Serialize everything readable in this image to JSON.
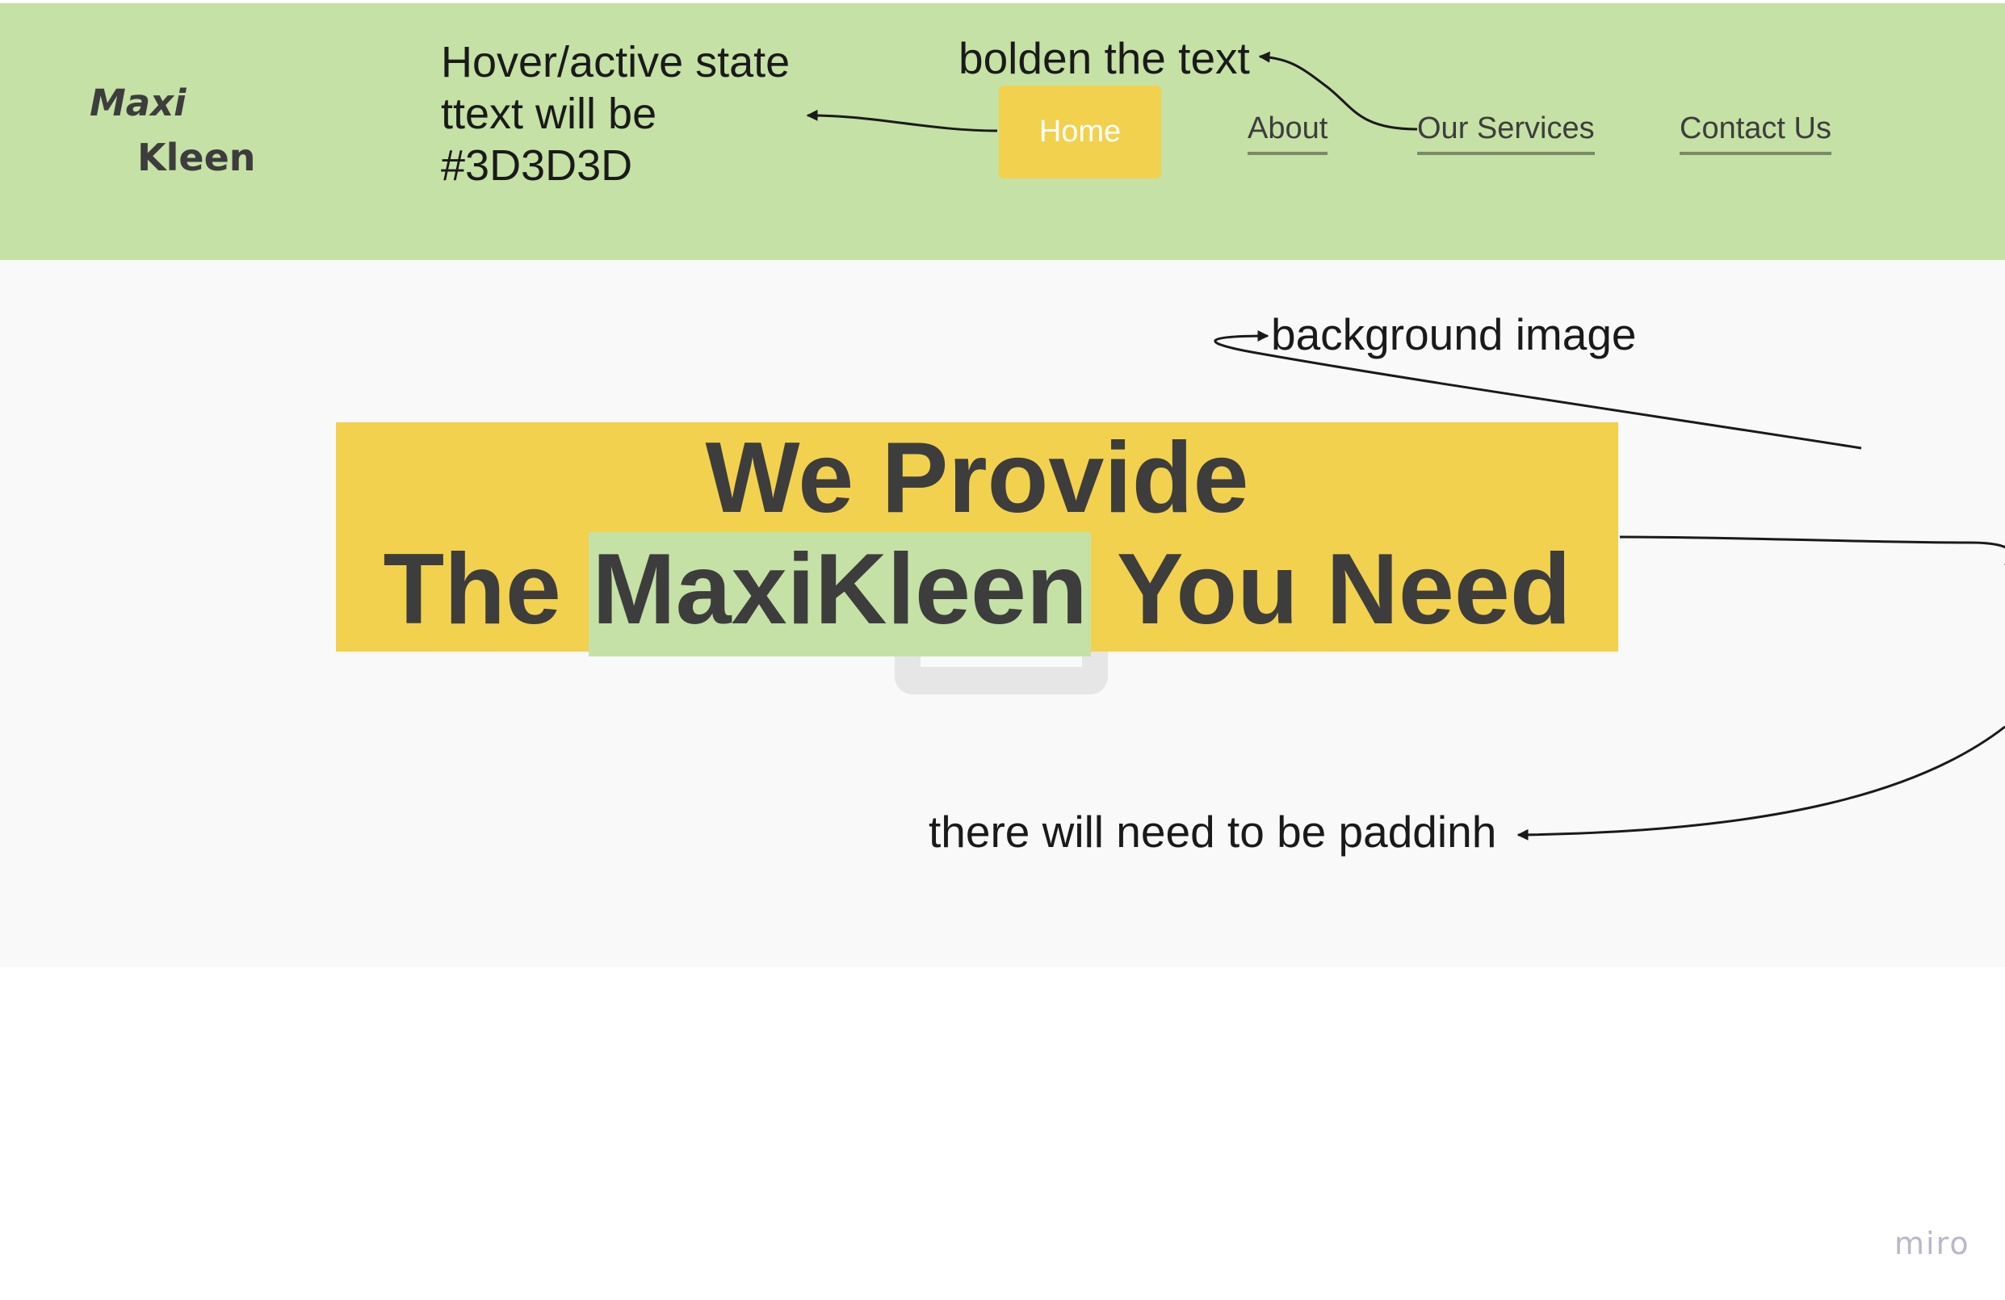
{
  "logo": {
    "line1": "Maxi",
    "line2": "Kleen"
  },
  "nav": {
    "items": [
      {
        "label": "Home",
        "active": true
      },
      {
        "label": "About"
      },
      {
        "label": "Our Services"
      },
      {
        "label": "Contact Us"
      }
    ]
  },
  "annotations": {
    "hover": [
      "Hover/active state",
      "ttext will be",
      "#3D3D3D"
    ],
    "bolden": "bolden the text",
    "background": "background image",
    "padding": "there will need to be paddinh"
  },
  "hero": {
    "line1": "We Provide",
    "line2_before": "The ",
    "line2_highlight": "MaxiKleen",
    "line2_after": " You Need"
  },
  "watermark": "miro",
  "colors": {
    "header_bg": "#c5e1a5",
    "accent_yellow": "#f2d14e",
    "text_dark": "#3d3d3d",
    "hero_bg": "#f9f9f9"
  }
}
